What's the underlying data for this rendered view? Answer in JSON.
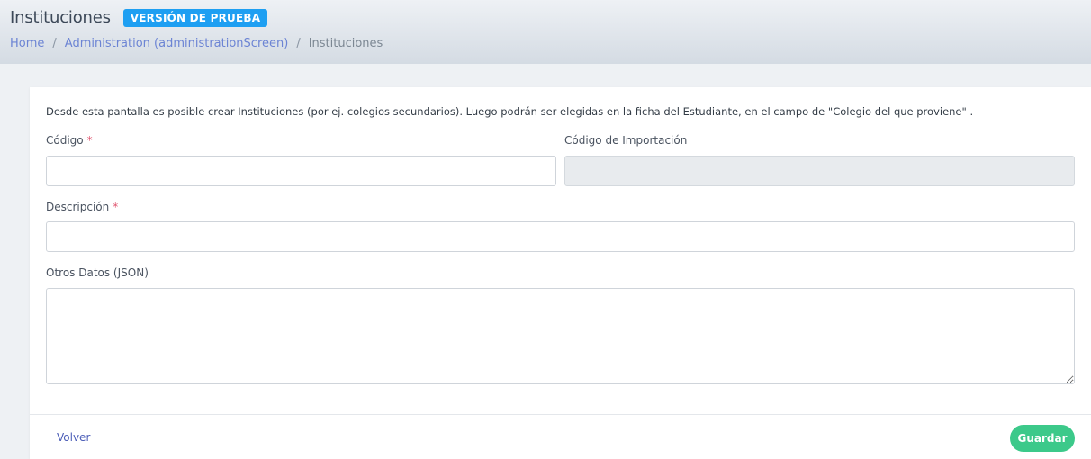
{
  "header": {
    "title": "Instituciones",
    "badge": "VERSIÓN DE PRUEBA",
    "breadcrumb": {
      "home": "Home",
      "separator": "/",
      "admin": "Administration (administrationScreen)",
      "current": "Instituciones"
    }
  },
  "form": {
    "intro": "Desde esta pantalla es posible crear Instituciones (por ej. colegios secundarios). Luego podrán ser elegidas en la ficha del Estudiante, en el campo de \"Colegio del que proviene\" .",
    "required_mark": "*",
    "codigo": {
      "label": "Código",
      "value": ""
    },
    "codigo_importacion": {
      "label": "Código de Importación",
      "value": ""
    },
    "descripcion": {
      "label": "Descripción",
      "value": ""
    },
    "otros_datos": {
      "label": "Otros Datos (JSON)",
      "value": ""
    }
  },
  "footer": {
    "back_label": "Volver",
    "save_label": "Guardar"
  },
  "colors": {
    "badge": "#1e9ff2",
    "link": "#6c84d4",
    "save_button": "#3cc98a",
    "required": "#e0546e"
  }
}
